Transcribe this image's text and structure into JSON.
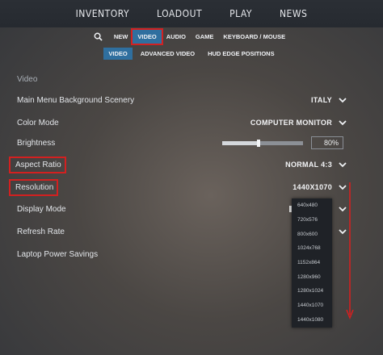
{
  "nav": {
    "items": [
      "INVENTORY",
      "LOADOUT",
      "PLAY",
      "NEWS"
    ]
  },
  "settings_tabs": {
    "items": [
      "NEW",
      "VIDEO",
      "AUDIO",
      "GAME",
      "KEYBOARD / MOUSE"
    ],
    "active": "VIDEO"
  },
  "video_tabs": {
    "items": [
      "VIDEO",
      "ADVANCED VIDEO",
      "HUD EDGE POSITIONS"
    ],
    "active": "VIDEO"
  },
  "section": {
    "title": "Video"
  },
  "rows": {
    "scenery": {
      "label": "Main Menu Background Scenery",
      "value": "ITALY"
    },
    "color_mode": {
      "label": "Color Mode",
      "value": "COMPUTER MONITOR"
    },
    "brightness": {
      "label": "Brightness",
      "value": "80%",
      "level": 0.45
    },
    "aspect_ratio": {
      "label": "Aspect Ratio",
      "value": "NORMAL 4:3"
    },
    "resolution": {
      "label": "Resolution",
      "value": "1440X1070"
    },
    "display_mode": {
      "label": "Display Mode"
    },
    "refresh_rate": {
      "label": "Refresh Rate"
    },
    "laptop_power": {
      "label": "Laptop Power Savings"
    }
  },
  "resolution_options": [
    "640x480",
    "720x576",
    "800x600",
    "1024x768",
    "1152x864",
    "1280x960",
    "1280x1024",
    "1440x1070",
    "1440x1080"
  ],
  "colors": {
    "accent_tab": "#2f6f9f",
    "highlight": "#d32020"
  },
  "icons": {
    "search": "search-icon",
    "chevron": "chevron-down-icon",
    "scroll_arrow": "arrow-down-icon"
  }
}
